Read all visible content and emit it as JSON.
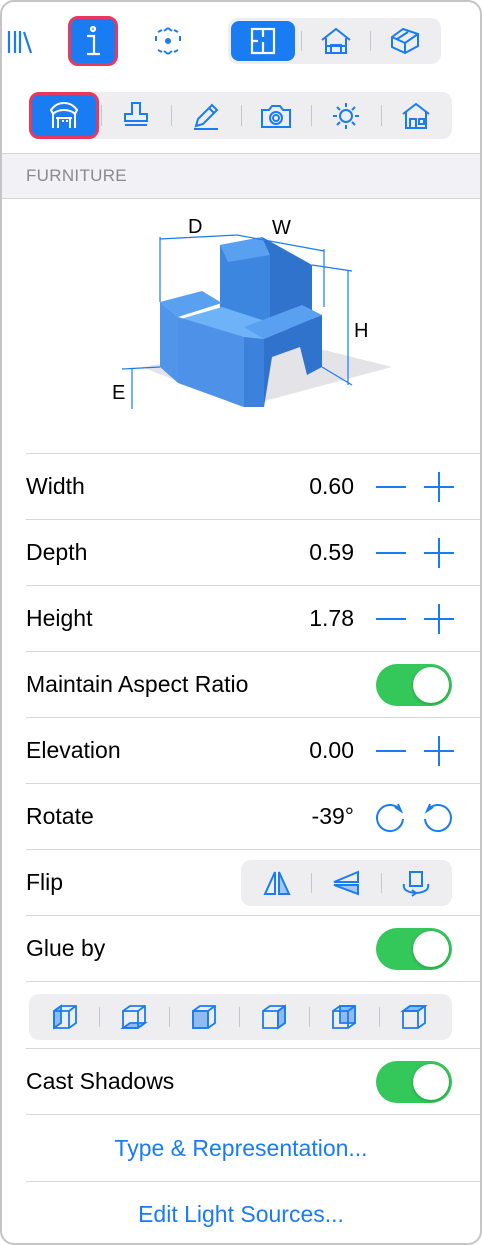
{
  "toolbar": {
    "library_icon": "library-icon",
    "info_icon": "info-icon",
    "selection_icon": "selection-icon",
    "view_modes": [
      "floor-plan-icon",
      "house-front-icon",
      "house-3d-icon"
    ]
  },
  "tools": [
    "furniture-dimensions-icon",
    "stamp-icon",
    "pencil-icon",
    "camera-icon",
    "sun-icon",
    "house-icon"
  ],
  "section": {
    "title": "FURNITURE"
  },
  "diagram": {
    "d_label": "D",
    "w_label": "W",
    "h_label": "H",
    "e_label": "E"
  },
  "rows": {
    "width": {
      "label": "Width",
      "value": "0.60"
    },
    "depth": {
      "label": "Depth",
      "value": "0.59"
    },
    "height": {
      "label": "Height",
      "value": "1.78"
    },
    "aspect": {
      "label": "Maintain Aspect Ratio"
    },
    "elevation": {
      "label": "Elevation",
      "value": "0.00"
    },
    "rotate": {
      "label": "Rotate",
      "value": "-39°"
    },
    "flip": {
      "label": "Flip"
    },
    "glue": {
      "label": "Glue by"
    },
    "shadows": {
      "label": "Cast Shadows"
    }
  },
  "links": {
    "type_representation": "Type & Representation...",
    "edit_light": "Edit Light Sources..."
  },
  "colors": {
    "accent": "#1a7cf2",
    "toggle_on": "#34c759",
    "highlight": "#e8385e"
  }
}
